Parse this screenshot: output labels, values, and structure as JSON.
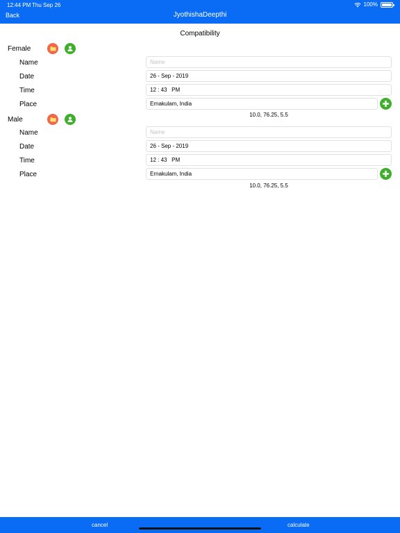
{
  "status_bar": {
    "time": "12:44 PM",
    "date": "Thu Sep 26",
    "battery": "100%"
  },
  "nav": {
    "back_label": "Back",
    "title": "JyothishaDeepthi"
  },
  "page_heading": "Compatibility",
  "labels": {
    "name": "Name",
    "date": "Date",
    "time": "Time",
    "place": "Place"
  },
  "female": {
    "title": "Female",
    "name_placeholder": "Name",
    "date": "26 - Sep - 2019",
    "time": "12 : 43   PM",
    "place": "Ernakulam, India",
    "coords": "10.0, 76.25, 5.5"
  },
  "male": {
    "title": "Male",
    "name_placeholder": "Name",
    "date": "26 - Sep - 2019",
    "time": "12 : 43   PM",
    "place": "Ernakulam, India",
    "coords": "10.0, 76.25, 5.5"
  },
  "footer": {
    "cancel_label": "cancel",
    "calculate_label": "calculate"
  },
  "colors": {
    "primary": "#0a6cf5",
    "folder_button": "#f0674c",
    "profile_button": "#3fae2a"
  },
  "icons": {
    "folder": "folder-icon",
    "profile": "person-icon",
    "add": "plus-icon"
  }
}
